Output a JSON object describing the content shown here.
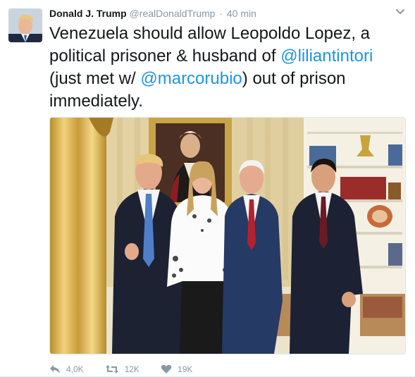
{
  "tweet": {
    "author_name": "Donald J. Trump",
    "handle": "@realDonaldTrump",
    "separator": "·",
    "time": "40 min",
    "text_part1": "Venezuela should allow Leopoldo Lopez, a political prisoner & husband of ",
    "mention1": "@liliantintori",
    "text_part2": " (just met w/ ",
    "mention2": "@marcorubio",
    "text_part3": ") out of prison immediately."
  },
  "actions": {
    "reply_icon": "reply-icon",
    "reply_count": "4,0K",
    "retweet_icon": "retweet-icon",
    "retweet_count": "12K",
    "like_icon": "heart-icon",
    "like_count": "19K"
  },
  "colors": {
    "mention": "#1b95e0",
    "muted": "#8899a6",
    "text": "#14171a"
  }
}
